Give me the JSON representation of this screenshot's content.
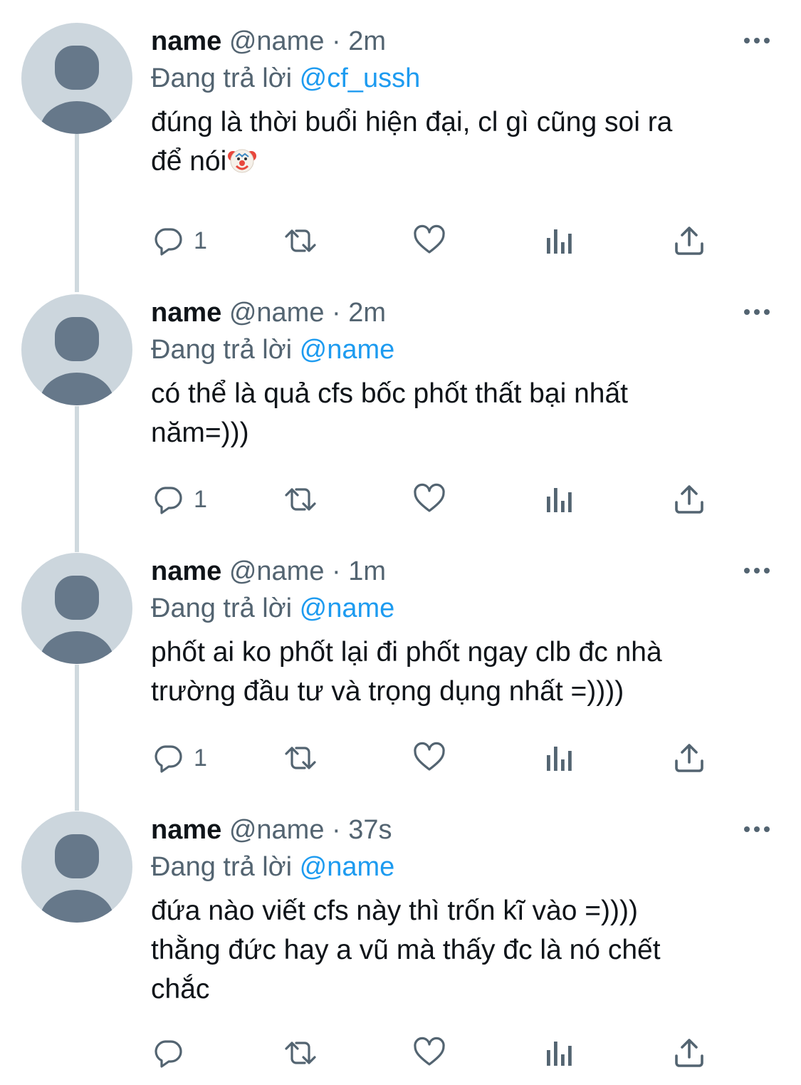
{
  "tweets": [
    {
      "display_name": "name",
      "handle": "@name",
      "separator": "·",
      "time": "2m",
      "reply_prefix": "Đang trả lời",
      "reply_to": "@cf_ussh",
      "text": "đúng là thời buổi hiện đại, cl gì cũng soi ra\nđể nói",
      "emoji": "clown-face-emoji",
      "reply_count": "1"
    },
    {
      "display_name": "name",
      "handle": "@name",
      "separator": "·",
      "time": "2m",
      "reply_prefix": "Đang trả lời",
      "reply_to": "@name",
      "text": "có thể là quả cfs bốc phốt thất bại nhất\nnăm=)))",
      "reply_count": "1"
    },
    {
      "display_name": "name",
      "handle": "@name",
      "separator": "·",
      "time": "1m",
      "reply_prefix": "Đang trả lời",
      "reply_to": "@name",
      "text": "phốt ai ko phốt lại đi phốt ngay clb đc nhà\ntrường đầu tư và trọng dụng nhất =))))",
      "reply_count": "1"
    },
    {
      "display_name": "name",
      "handle": "@name",
      "separator": "·",
      "time": "37s",
      "reply_prefix": "Đang trả lời",
      "reply_to": "@name",
      "text": "đứa nào viết cfs này thì trốn kĩ vào =))))\nthằng đức hay a vũ mà thấy đc là nó chết\nchắc",
      "reply_count": ""
    }
  ],
  "icons": {
    "reply": "reply-icon",
    "retweet": "retweet-icon",
    "like": "like-icon",
    "views": "views-icon",
    "share": "share-icon",
    "more": "more-icon"
  },
  "colors": {
    "text": "#0f1419",
    "secondary": "#536471",
    "mention": "#1d9bf0",
    "avatar_bg": "#ccd6dd",
    "avatar_figure": "#66788a",
    "thread_line": "#cfd9de"
  }
}
